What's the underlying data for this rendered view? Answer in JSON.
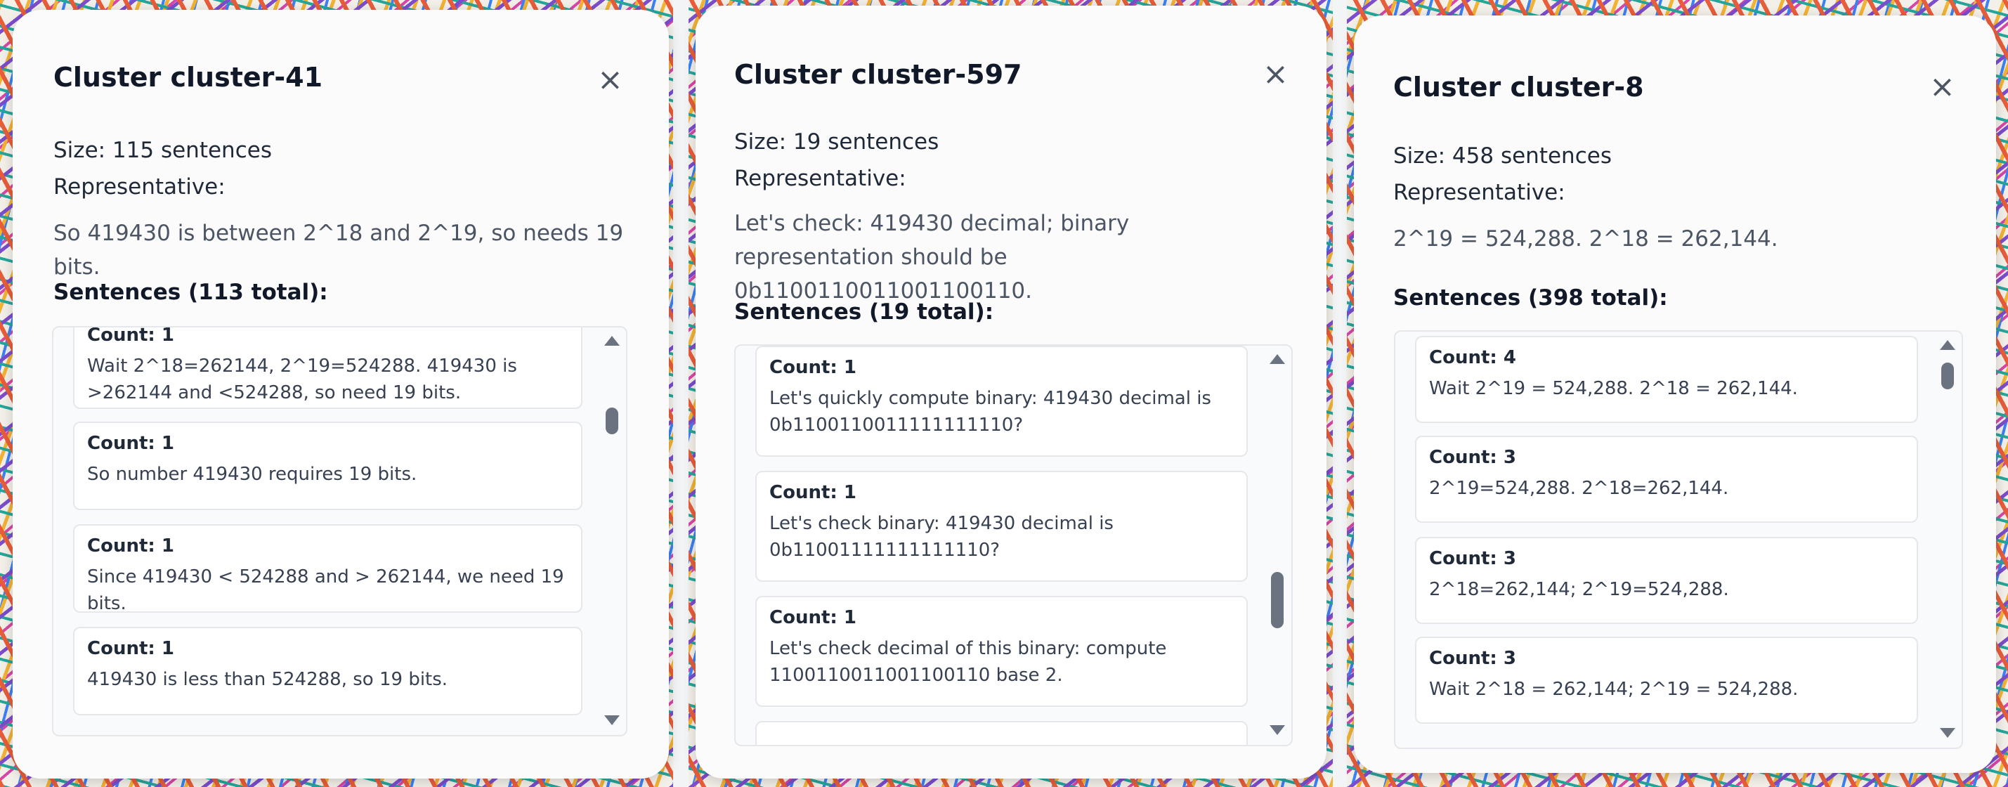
{
  "panels": [
    {
      "title": "Cluster cluster-41",
      "close_icon": "×",
      "size_text": "Size: 115 sentences",
      "representative_label": "Representative:",
      "representative_text": "So 419430 is between 2^18 and 2^19, so needs 19 bits.",
      "sentences_title": "Sentences (113 total):",
      "sentences": [
        {
          "count": "Count: 1",
          "text": "Wait 2^18=262144, 2^19=524288. 419430 is >262144 and <524288, so need 19 bits."
        },
        {
          "count": "Count: 1",
          "text": "So number 419430 requires 19 bits."
        },
        {
          "count": "Count: 1",
          "text": "Since 419430 < 524288 and > 262144, we need 19 bits."
        },
        {
          "count": "Count: 1",
          "text": "419430 is less than 524288, so 19 bits."
        }
      ]
    },
    {
      "title": "Cluster cluster-597",
      "close_icon": "×",
      "size_text": "Size: 19 sentences",
      "representative_label": "Representative:",
      "representative_text": "Let's check: 419430 decimal; binary representation should be 0b1100110011001100110.",
      "sentences_title": "Sentences (19 total):",
      "sentences": [
        {
          "count": "Count: 1",
          "text": "Let's quickly compute binary: 419430 decimal is 0b1100110011111111110?"
        },
        {
          "count": "Count: 1",
          "text": "Let's check binary: 419430 decimal is 0b11001111111111110?"
        },
        {
          "count": "Count: 1",
          "text": "Let's check decimal of this binary: compute 1100110011001100110 base 2."
        },
        {
          "count": "",
          "text": ""
        }
      ]
    },
    {
      "title": "Cluster cluster-8",
      "close_icon": "×",
      "size_text": "Size: 458 sentences",
      "representative_label": "Representative:",
      "representative_text": "2^19 = 524,288. 2^18 = 262,144.",
      "sentences_title": "Sentences (398 total):",
      "sentences": [
        {
          "count": "Count: 4",
          "text": "Wait 2^19 = 524,288. 2^18 = 262,144."
        },
        {
          "count": "Count: 3",
          "text": "2^19=524,288. 2^18=262,144."
        },
        {
          "count": "Count: 3",
          "text": "2^18=262,144; 2^19=524,288."
        },
        {
          "count": "Count: 3",
          "text": "Wait 2^18 = 262,144; 2^19 = 524,288."
        }
      ]
    }
  ]
}
